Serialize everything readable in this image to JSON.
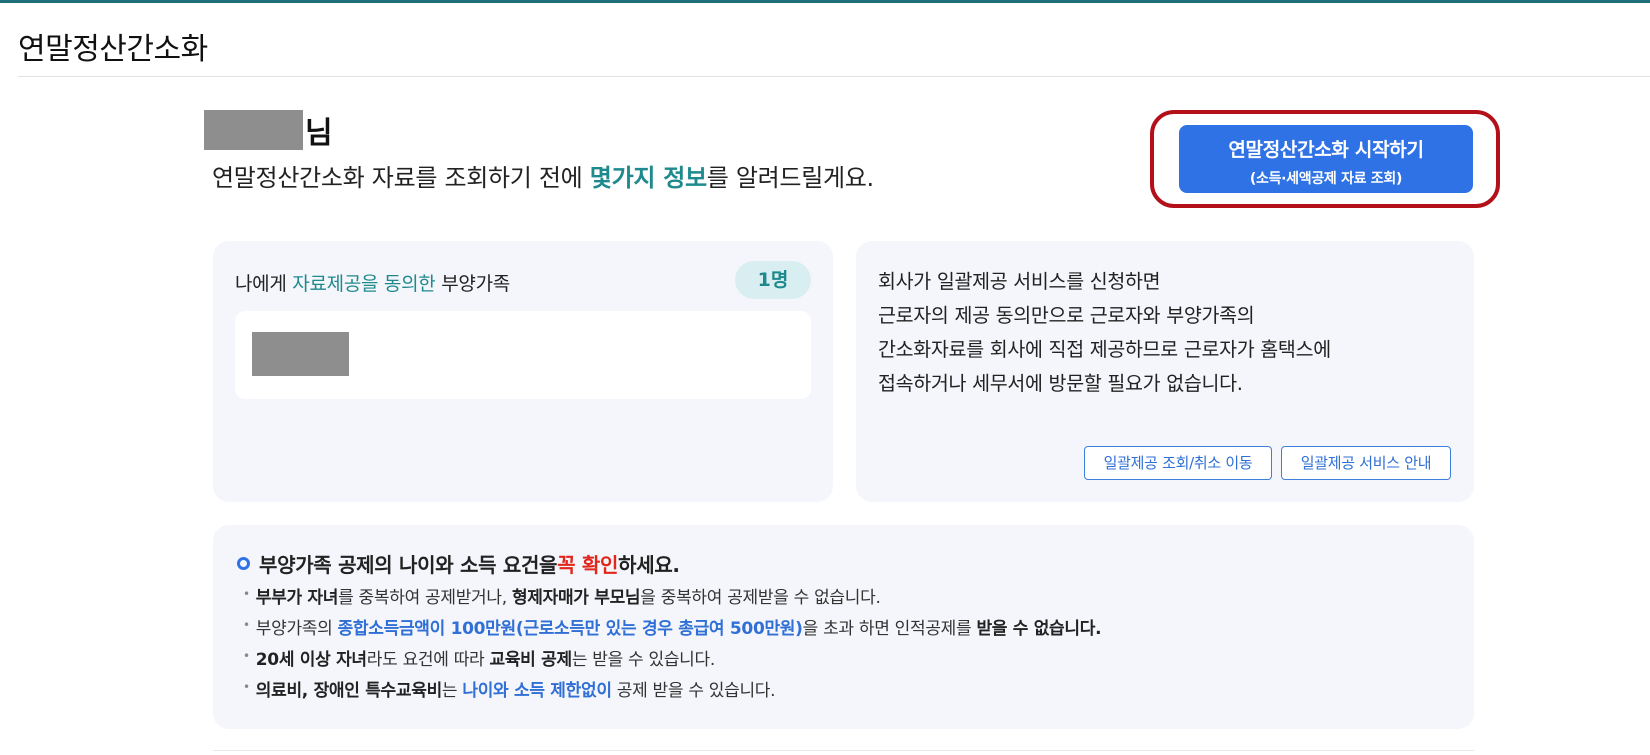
{
  "page": {
    "title": "연말정산간소화"
  },
  "greeting": {
    "honorific": "님",
    "intro_prefix": "연말정산간소화 자료를 조회하기 전에 ",
    "intro_highlight": "몇가지 정보",
    "intro_suffix": "를 알려드릴게요."
  },
  "start_button": {
    "label": "연말정산간소화 시작하기",
    "sublabel": "(소득·세액공제 자료 조회)"
  },
  "consent_card": {
    "title_prefix": "나에게 ",
    "title_highlight": "자료제공을 동의한",
    "title_suffix": " 부양가족",
    "count": "1명"
  },
  "bulk_card": {
    "lines": [
      "회사가 일괄제공 서비스를 신청하면",
      "근로자의 제공 동의만으로 근로자와 부양가족의",
      "간소화자료를 회사에 직접 제공하므로 근로자가 홈택스에",
      "접속하거나 세무서에 방문할 필요가 없습니다."
    ],
    "lookup_button": "일괄제공 조회/취소 이동",
    "guide_button": "일괄제공 서비스 안내"
  },
  "info_card": {
    "title_prefix": "부양가족 공제의 나이와 소득 요건을 ",
    "title_red": "꼭 확인",
    "title_suffix": "하세요.",
    "b1": {
      "bold1": "부부가 자녀",
      "t1": "를 중복하여 공제받거나, ",
      "bold2": "형제자매가 부모님",
      "t2": "을 중복하여 공제받을 수 없습니다."
    },
    "b2": {
      "t1": "부양가족의 ",
      "blue": "종합소득금액이 100만원(근로소득만 있는 경우 총급여 500만원)",
      "t2": "을 초과 하면 인적공제를 ",
      "bold": "받을 수 없습니다."
    },
    "b3": {
      "bold1": "20세 이상 자녀",
      "t1": "라도 요건에 따라 ",
      "bold2": "교육비 공제",
      "t2": "는 받을 수 있습니다."
    },
    "b4": {
      "bold": "의료비, 장애인 특수교육비",
      "t1": "는 ",
      "blue": "나이와 소득 제한없이",
      "t2": " 공제 받을 수 있습니다."
    }
  }
}
